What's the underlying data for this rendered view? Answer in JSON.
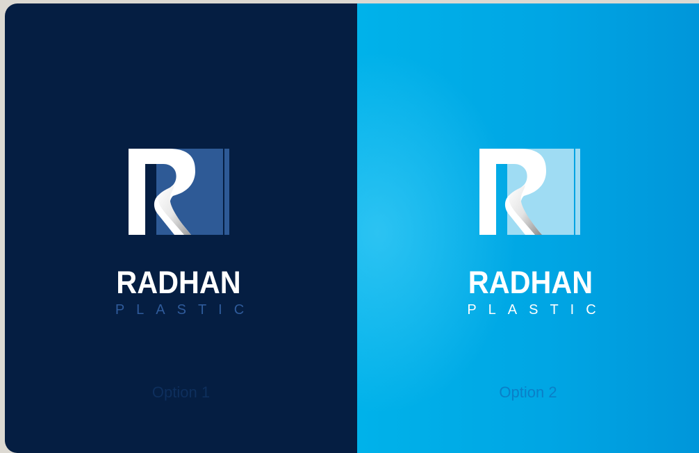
{
  "options": [
    {
      "brand": "RADHAN",
      "tagline": "PLASTIC",
      "label": "Option 1",
      "colors": {
        "background": "#051e42",
        "wordmark": "#ffffff",
        "tagline": "#2f5b9b",
        "label": "#0e2f5d",
        "mark_panel": "#2e5a96",
        "mark_letter": "#ffffff"
      },
      "icon": "r-ribbon-logo-icon"
    },
    {
      "brand": "RADHAN",
      "tagline": "PLASTIC",
      "label": "Option 2",
      "colors": {
        "background": "#00a6e4",
        "wordmark": "#ffffff",
        "tagline": "#ffffff",
        "label": "#0a7fc7",
        "mark_panel": "#9fdcf3",
        "mark_letter": "#ffffff"
      },
      "icon": "r-ribbon-logo-icon"
    }
  ]
}
